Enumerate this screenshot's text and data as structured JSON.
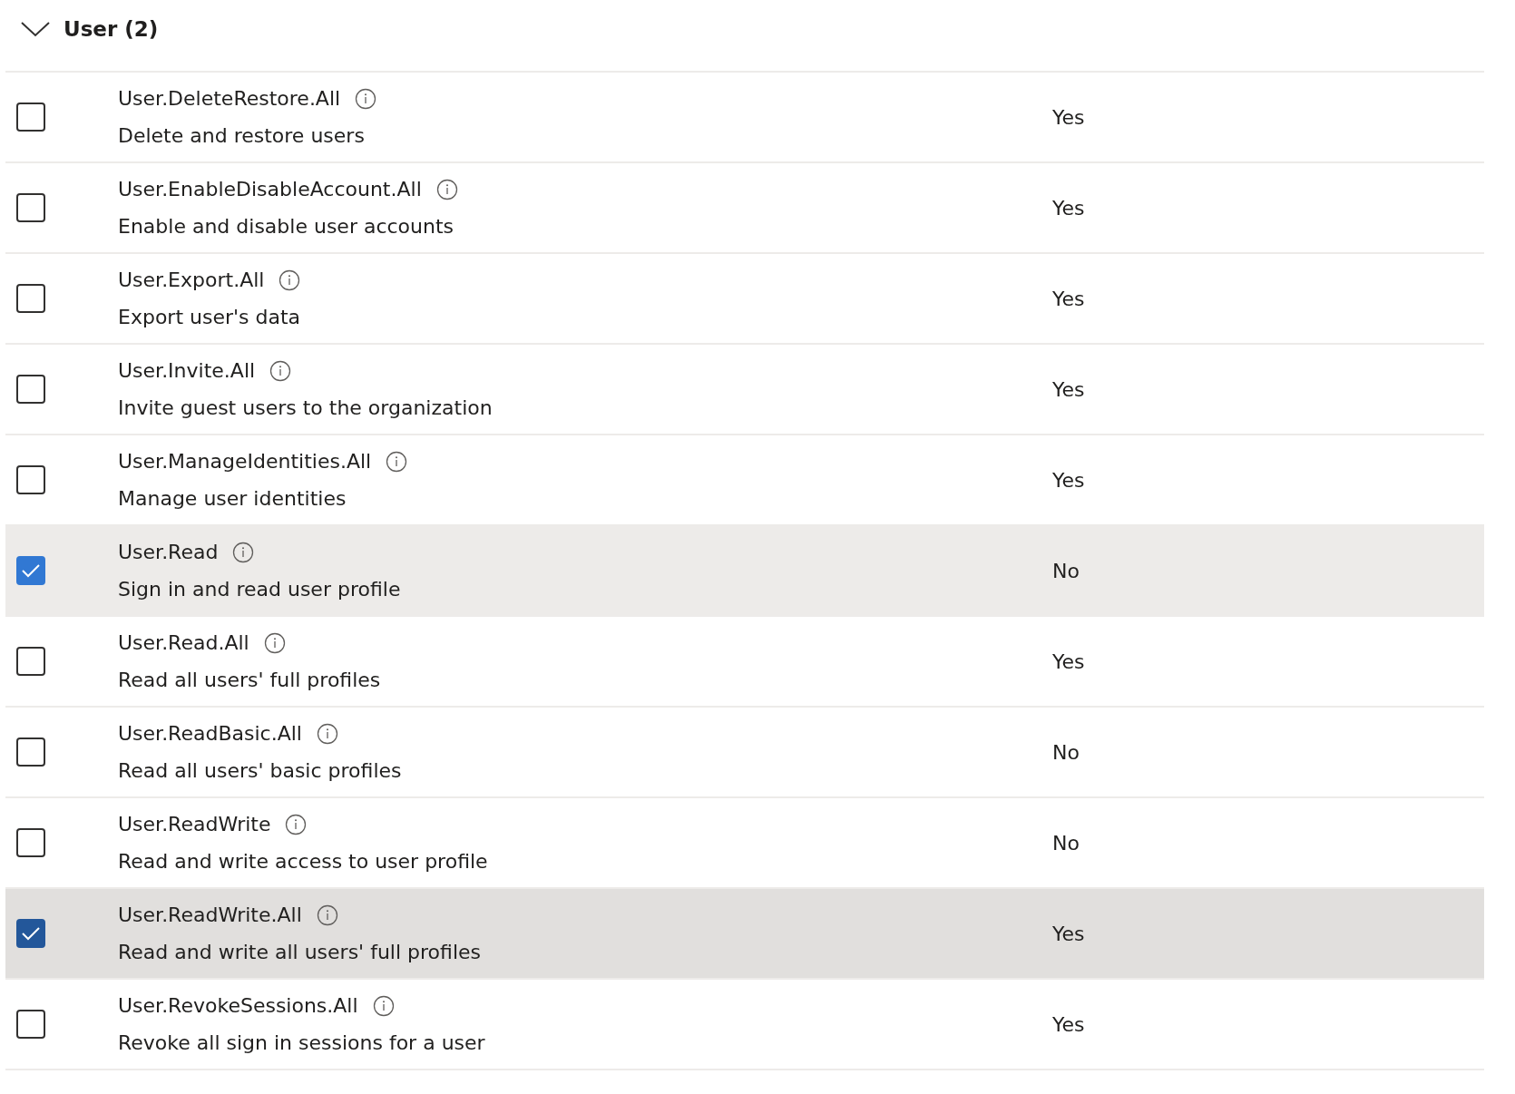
{
  "group": {
    "title": "User (2)",
    "expanded": true
  },
  "permissions": [
    {
      "name": "User.DeleteRestore.All",
      "description": "Delete and restore users",
      "admin_consent": "Yes",
      "checked": false,
      "selected": false,
      "hovered": false
    },
    {
      "name": "User.EnableDisableAccount.All",
      "description": "Enable and disable user accounts",
      "admin_consent": "Yes",
      "checked": false,
      "selected": false,
      "hovered": false
    },
    {
      "name": "User.Export.All",
      "description": "Export user's data",
      "admin_consent": "Yes",
      "checked": false,
      "selected": false,
      "hovered": false
    },
    {
      "name": "User.Invite.All",
      "description": "Invite guest users to the organization",
      "admin_consent": "Yes",
      "checked": false,
      "selected": false,
      "hovered": false
    },
    {
      "name": "User.ManageIdentities.All",
      "description": "Manage user identities",
      "admin_consent": "Yes",
      "checked": false,
      "selected": false,
      "hovered": false
    },
    {
      "name": "User.Read",
      "description": "Sign in and read user profile",
      "admin_consent": "No",
      "checked": true,
      "selected": true,
      "hovered": false
    },
    {
      "name": "User.Read.All",
      "description": "Read all users' full profiles",
      "admin_consent": "Yes",
      "checked": false,
      "selected": false,
      "hovered": false
    },
    {
      "name": "User.ReadBasic.All",
      "description": "Read all users' basic profiles",
      "admin_consent": "No",
      "checked": false,
      "selected": false,
      "hovered": false
    },
    {
      "name": "User.ReadWrite",
      "description": "Read and write access to user profile",
      "admin_consent": "No",
      "checked": false,
      "selected": false,
      "hovered": false
    },
    {
      "name": "User.ReadWrite.All",
      "description": "Read and write all users' full profiles",
      "admin_consent": "Yes",
      "checked": true,
      "selected": true,
      "hovered": true
    },
    {
      "name": "User.RevokeSessions.All",
      "description": "Revoke all sign in sessions for a user",
      "admin_consent": "Yes",
      "checked": false,
      "selected": false,
      "hovered": false
    }
  ]
}
